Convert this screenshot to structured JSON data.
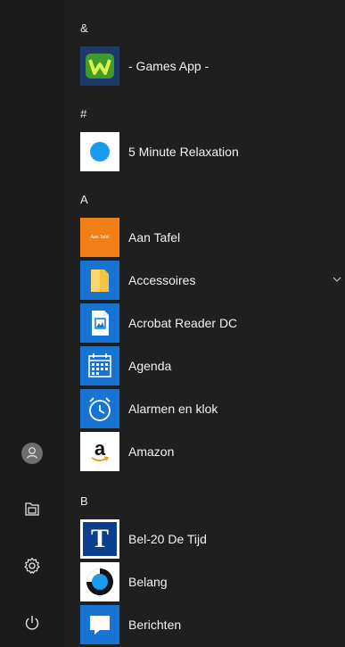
{
  "sections": [
    {
      "letter": "&",
      "apps": [
        {
          "label": "- Games App -",
          "icon": "games-app-icon",
          "tile_color": "#1e3a6b"
        }
      ]
    },
    {
      "letter": "#",
      "apps": [
        {
          "label": "5 Minute Relaxation",
          "icon": "relaxation-icon",
          "tile_color": "#ffffff"
        }
      ]
    },
    {
      "letter": "A",
      "apps": [
        {
          "label": "Aan Tafel",
          "icon": "aan-tafel-icon",
          "tile_color": "#f07f16",
          "tile_text": "Aan Tafel"
        },
        {
          "label": "Accessoires",
          "icon": "folder-icon",
          "tile_color": "#1874d2",
          "expandable": true
        },
        {
          "label": "Acrobat Reader DC",
          "icon": "acrobat-icon",
          "tile_color": "#1874d2"
        },
        {
          "label": "Agenda",
          "icon": "calendar-icon",
          "tile_color": "#1874d2"
        },
        {
          "label": "Alarmen en klok",
          "icon": "alarm-clock-icon",
          "tile_color": "#1874d2"
        },
        {
          "label": "Amazon",
          "icon": "amazon-icon",
          "tile_color": "#ffffff",
          "tile_text": "a"
        }
      ]
    },
    {
      "letter": "B",
      "apps": [
        {
          "label": "Bel-20  De Tijd",
          "icon": "de-tijd-icon",
          "tile_color": "#ffffff",
          "tile_text": "T"
        },
        {
          "label": "Belang",
          "icon": "belang-icon",
          "tile_color": "#ffffff"
        },
        {
          "label": "Berichten",
          "icon": "messages-icon",
          "tile_color": "#1874d2"
        }
      ]
    }
  ],
  "rail": [
    {
      "name": "user-avatar",
      "icon": "user-icon"
    },
    {
      "name": "documents",
      "icon": "documents-icon"
    },
    {
      "name": "settings",
      "icon": "gear-icon"
    },
    {
      "name": "power",
      "icon": "power-icon"
    }
  ],
  "colors": {
    "background": "#1f1f1f",
    "rail": "#1b1b1b",
    "accent": "#1874d2"
  }
}
